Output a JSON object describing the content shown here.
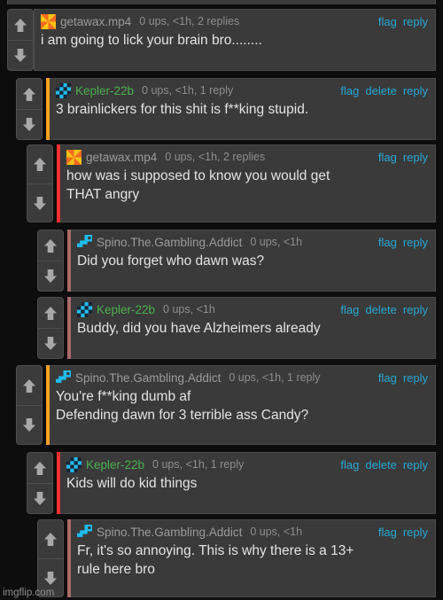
{
  "site": {
    "watermark": "imgflip.com",
    "background": "#0d0d0d",
    "panel_bg": "#3a3a3a",
    "link_color": "#27a8d4",
    "username_gray": "#9b9b9b",
    "username_green": "#4caf50",
    "depth_colors": [
      "#f5a11e",
      "#f03030",
      "#a86a6a"
    ]
  },
  "labels": {
    "flag": "flag",
    "delete": "delete",
    "reply": "reply",
    "upvote_icon": "up-arrow-icon",
    "downvote_icon": "down-arrow-icon"
  },
  "comments": [
    {
      "id": "c1",
      "username": "getawax.mp4",
      "username_color": "gray",
      "avatar": "pinwheel-orange-avatar",
      "meta": "0 ups, <1h, 2 replies",
      "text": "i am going to lick your brain bro........",
      "actions": [
        "flag",
        "reply"
      ],
      "depth": 0
    },
    {
      "id": "c2",
      "username": "Kepler-22b",
      "username_color": "green",
      "avatar": "checker-cyan-avatar",
      "meta": "0 ups, <1h, 1 reply",
      "text": "3 brainlickers for this shit is f**king stupid.",
      "actions": [
        "flag",
        "delete",
        "reply"
      ],
      "depth": 1
    },
    {
      "id": "c3",
      "username": "getawax.mp4",
      "username_color": "gray",
      "avatar": "pinwheel-orange-avatar",
      "meta": "0 ups, <1h, 2 replies",
      "text": "how was i supposed to know you would get\nTHAT angry",
      "actions": [
        "flag",
        "reply"
      ],
      "depth": 2
    },
    {
      "id": "c4",
      "username": "Spino.The.Gambling.Addict",
      "username_color": "gray",
      "avatar": "spino-cyan-avatar",
      "meta": "0 ups, <1h",
      "text": "Did you forget who dawn was?",
      "actions": [
        "flag",
        "reply"
      ],
      "depth": 3
    },
    {
      "id": "c5",
      "username": "Kepler-22b",
      "username_color": "green",
      "avatar": "checker-cyan-avatar",
      "meta": "0 ups, <1h",
      "text": "Buddy, did you have Alzheimers already",
      "actions": [
        "flag",
        "delete",
        "reply"
      ],
      "depth": 3
    },
    {
      "id": "c6",
      "username": "Spino.The.Gambling.Addict",
      "username_color": "gray",
      "avatar": "spino-cyan-avatar",
      "meta": "0 ups, <1h, 1 reply",
      "text": "You're f**king dumb af\nDefending dawn for 3 terrible ass Candy?",
      "actions": [
        "flag",
        "reply"
      ],
      "depth": 1
    },
    {
      "id": "c7",
      "username": "Kepler-22b",
      "username_color": "green",
      "avatar": "checker-cyan-avatar",
      "meta": "0 ups, <1h, 1 reply",
      "text": "Kids will do kid things",
      "actions": [
        "flag",
        "delete",
        "reply"
      ],
      "depth": 2
    },
    {
      "id": "c8",
      "username": "Spino.The.Gambling.Addict",
      "username_color": "gray",
      "avatar": "spino-cyan-avatar",
      "meta": "0 ups, <1h",
      "text": "Fr, it's so annoying. This is why there is a 13+\nrule here bro",
      "actions": [
        "flag",
        "reply"
      ],
      "depth": 3
    }
  ]
}
